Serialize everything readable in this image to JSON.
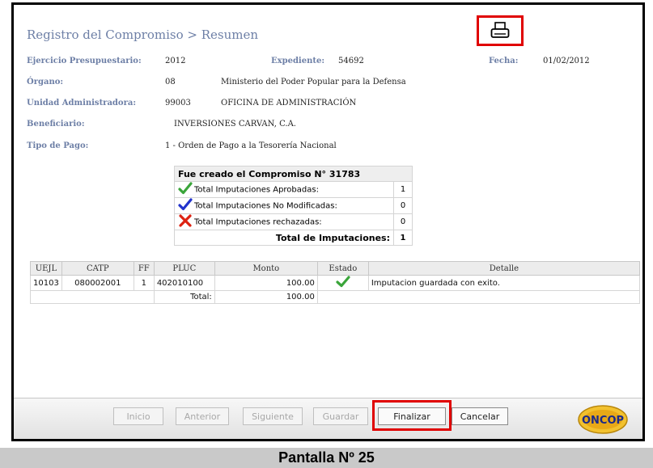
{
  "header": {
    "title": "Registro del Compromiso > Resumen",
    "print_icon": "printer-icon"
  },
  "fields": {
    "ejercicio_label": "Ejercicio Presupuestario:",
    "ejercicio_value": "2012",
    "expediente_label": "Expediente:",
    "expediente_value": "54692",
    "fecha_label": "Fecha:",
    "fecha_value": "01/02/2012",
    "organo_label": "Órgano:",
    "organo_code": "08",
    "organo_name": "Ministerio del Poder Popular para la Defensa",
    "unidad_label": "Unidad Administradora:",
    "unidad_code": "99003",
    "unidad_name": "OFICINA DE ADMINISTRACIÓN",
    "beneficiario_label": "Beneficiario:",
    "beneficiario_value": "INVERSIONES CARVAN, C.A.",
    "tipo_pago_label": "Tipo de Pago:",
    "tipo_pago_value": "1 - Orden de Pago a la Tesorería Nacional"
  },
  "summary": {
    "header": "Fue creado el Compromiso N° 31783",
    "rows": [
      {
        "icon": "green-check-icon",
        "label": "Total Imputaciones Aprobadas:",
        "value": "1"
      },
      {
        "icon": "blue-check-icon",
        "label": "Total Imputaciones No Modificadas:",
        "value": "0"
      },
      {
        "icon": "red-x-icon",
        "label": "Total Imputaciones rechazadas:",
        "value": "0"
      }
    ],
    "total_label": "Total de Imputaciones:",
    "total_value": "1"
  },
  "table": {
    "columns": [
      "UEJL",
      "CATP",
      "FF",
      "PLUC",
      "Monto",
      "Estado",
      "Detalle"
    ],
    "rows": [
      {
        "uejl": "10103",
        "catp": "080002001",
        "ff": "1",
        "pluc": "402010100",
        "monto": "100.00",
        "estado_icon": "green-check-icon",
        "detalle": "Imputacion guardada con exito."
      }
    ],
    "total_label": "Total:",
    "total_value": "100.00"
  },
  "toolbar": {
    "inicio": "Inicio",
    "anterior": "Anterior",
    "siguiente": "Siguiente",
    "guardar": "Guardar",
    "finalizar": "Finalizar",
    "cancelar": "Cancelar",
    "logo_text": "ONCOP"
  },
  "caption": "Pantalla Nº 25",
  "colors": {
    "label_blue": "#6d7fa6",
    "highlight_red": "#e00000",
    "check_green": "#3aa53a",
    "check_blue": "#2233cc",
    "x_red": "#dd2211"
  }
}
